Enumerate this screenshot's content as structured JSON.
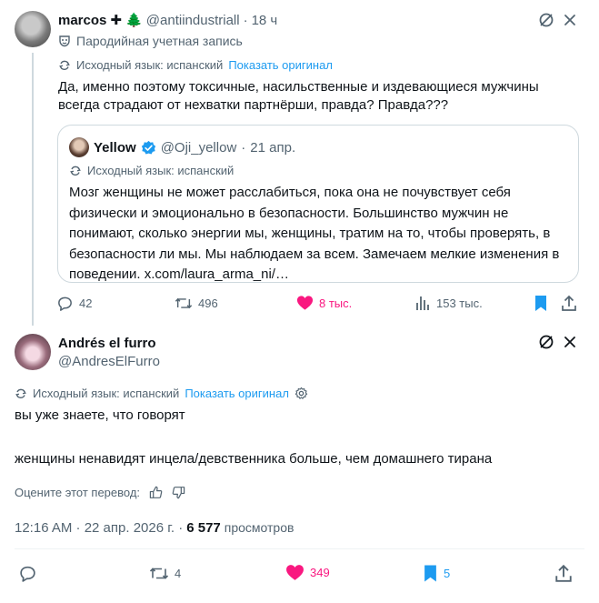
{
  "first_tweet": {
    "author_name": "marcos",
    "author_badges": "✚ 🌲",
    "author_handle": "@antiindustriall",
    "time": "18 ч",
    "parody_label": "Пародийная учетная запись",
    "translation_label": "Исходный язык: испанский",
    "show_original": "Показать оригинал",
    "text": "Да, именно поэтому токсичные, насильственные и издевающиеся мужчины всегда страдают от нехватки партнёрши, правда? Правда???",
    "quote": {
      "author_name": "Yellow",
      "author_handle": "@Oji_yellow",
      "time": "21 апр.",
      "translation_label": "Исходный язык: испанский",
      "text": "Мозг женщины не может расслабиться, пока она не почувствует себя физически и эмоционально в безопасности. Большинство мужчин не понимают, сколько энергии мы, женщины, тратим на то, чтобы проверять, в безопасности ли мы. Мы наблюдаем за всем. Замечаем мелкие изменения в поведении. x.com/laura_arma_ni/…"
    },
    "actions": {
      "replies": "42",
      "reposts": "496",
      "likes": "8 тыс.",
      "views": "153 тыс."
    }
  },
  "main_tweet": {
    "author_name": "Andrés el furro",
    "author_handle": "@AndresElFurro",
    "translation_label": "Исходный язык: испанский",
    "show_original": "Показать оригинал",
    "text_line1": "вы уже знаете, что говорят",
    "text_line2": "женщины ненавидят инцела/девственника больше, чем домашнего тирана",
    "rate_translation": "Оцените этот перевод:",
    "timestamp": "12:16 AM · 22 апр. 2026 г. ·",
    "view_count": "6 577",
    "views_label": "просмотров",
    "actions": {
      "replies": "",
      "reposts": "4",
      "likes": "349",
      "bookmarks": "5"
    }
  },
  "colors": {
    "accent_blue": "#1d9bf0",
    "like_pink": "#f91880",
    "secondary_text": "#536471",
    "verified_badge": "#1d9bf0"
  },
  "icons": [
    "grok-icon",
    "more-icon",
    "parody-mask-icon",
    "translate-icon",
    "verified-icon",
    "reply-icon",
    "repost-icon",
    "like-icon",
    "views-icon",
    "bookmark-icon",
    "share-icon",
    "thumbs-up-icon",
    "thumbs-down-icon",
    "settings-icon"
  ]
}
